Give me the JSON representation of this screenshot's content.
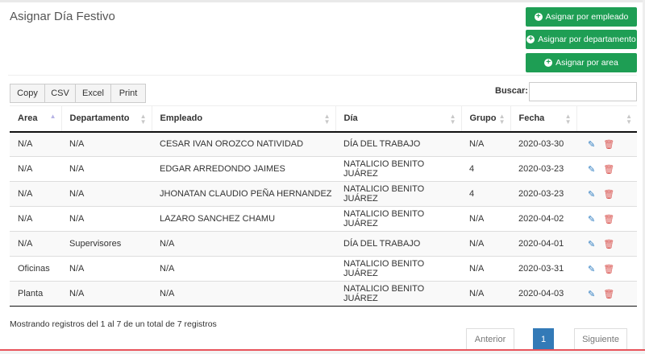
{
  "title": "Asignar Día Festivo",
  "actions": [
    {
      "label": "Asignar por empleado"
    },
    {
      "label": "Asignar por departamento"
    },
    {
      "label": "Asignar por area"
    }
  ],
  "exports": [
    "Copy",
    "CSV",
    "Excel",
    "Print"
  ],
  "search": {
    "label": "Buscar:",
    "value": ""
  },
  "columns": [
    "Area",
    "Departamento",
    "Empleado",
    "Día",
    "Grupo",
    "Fecha",
    ""
  ],
  "rows": [
    [
      "N/A",
      "N/A",
      "CESAR IVAN OROZCO NATIVIDAD",
      "DÍA DEL TRABAJO",
      "N/A",
      "2020-03-30"
    ],
    [
      "N/A",
      "N/A",
      "EDGAR ARREDONDO JAIMES",
      "NATALICIO BENITO JUÁREZ",
      "4",
      "2020-03-23"
    ],
    [
      "N/A",
      "N/A",
      "JHONATAN CLAUDIO PEÑA HERNANDEZ",
      "NATALICIO BENITO JUÁREZ",
      "4",
      "2020-03-23"
    ],
    [
      "N/A",
      "N/A",
      "LAZARO SANCHEZ CHAMU",
      "NATALICIO BENITO JUÁREZ",
      "N/A",
      "2020-04-02"
    ],
    [
      "N/A",
      "Supervisores",
      "N/A",
      "DÍA DEL TRABAJO",
      "N/A",
      "2020-04-01"
    ],
    [
      "Oficinas",
      "N/A",
      "N/A",
      "NATALICIO BENITO JUÁREZ",
      "N/A",
      "2020-03-31"
    ],
    [
      "Planta",
      "N/A",
      "N/A",
      "NATALICIO BENITO JUÁREZ",
      "N/A",
      "2020-04-03"
    ]
  ],
  "info": "Mostrando registros del 1 al 7 de un total de 7 registros",
  "pagination": {
    "prev": "Anterior",
    "page": "1",
    "next": "Siguiente"
  },
  "colors": {
    "accent": "#1e9e54",
    "primary": "#337ab7",
    "danger": "#d9534f"
  },
  "icons": {
    "edit": "pencil-icon",
    "delete": "trash-icon",
    "add": "plus-circle-icon"
  }
}
